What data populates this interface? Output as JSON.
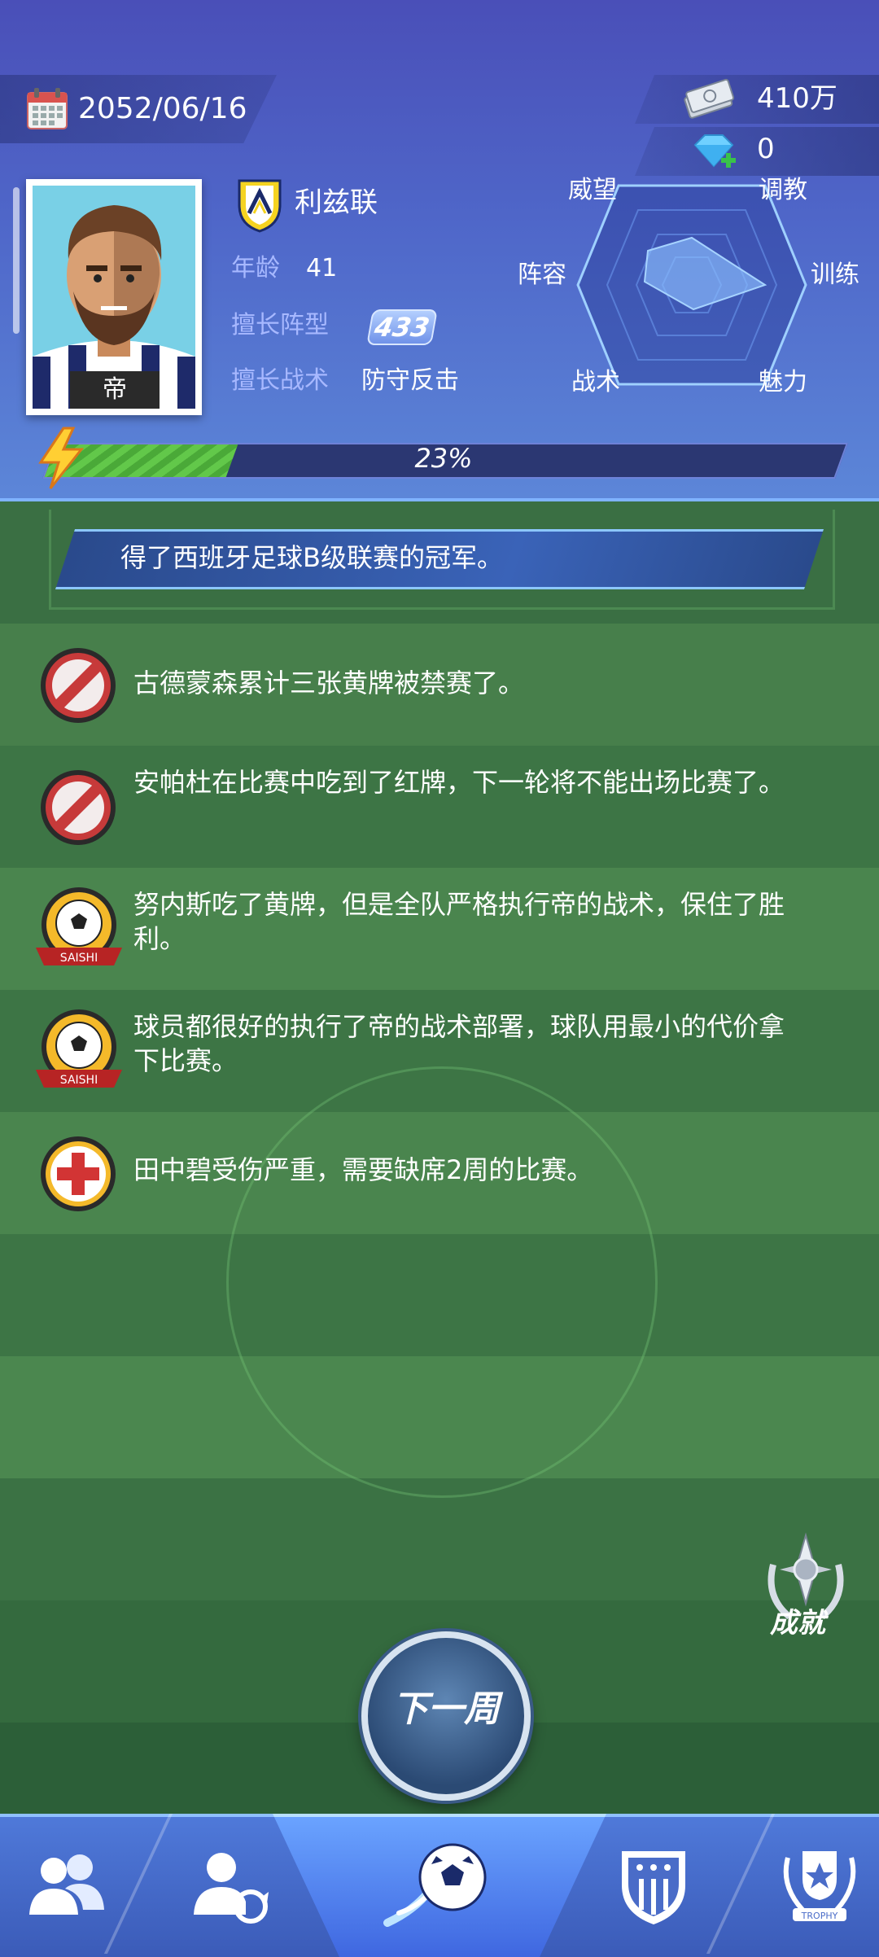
{
  "header": {
    "date": "2052/06/16",
    "money": "410万",
    "gems": "0"
  },
  "manager": {
    "name_tag": "帝",
    "club": "利兹联",
    "age_label": "年龄",
    "age": "41",
    "formation_label": "擅长阵型",
    "formation": "433",
    "tactic_label": "擅长战术",
    "tactic": "防守反击"
  },
  "radar": {
    "labels": [
      "威望",
      "调教",
      "训练",
      "魅力",
      "战术",
      "阵容"
    ]
  },
  "progress": {
    "value": 0.23,
    "label": "23%"
  },
  "news_banner": "得了西班牙足球B级联赛的冠军。",
  "events": [
    {
      "icon": "banned-icon",
      "text": "古德蒙森累计三张黄牌被禁赛了。"
    },
    {
      "icon": "banned-icon",
      "text": "安帕杜在比赛中吃到了红牌，下一轮将不能出场比赛了。"
    },
    {
      "icon": "saishi-ball-icon",
      "text": "努内斯吃了黄牌，但是全队严格执行帝的战术，保住了胜利。"
    },
    {
      "icon": "saishi-ball-icon",
      "text": "球员都很好的执行了帝的战术部署，球队用最小的代价拿下比赛。"
    },
    {
      "icon": "medical-cross-icon",
      "text": "田中碧受伤严重，需要缺席2周的比赛。"
    }
  ],
  "saishi_text": "SAISHI",
  "achievement_label": "成就",
  "next_week_label": "下一周",
  "nav": {
    "trophy_text": "TROPHY"
  }
}
